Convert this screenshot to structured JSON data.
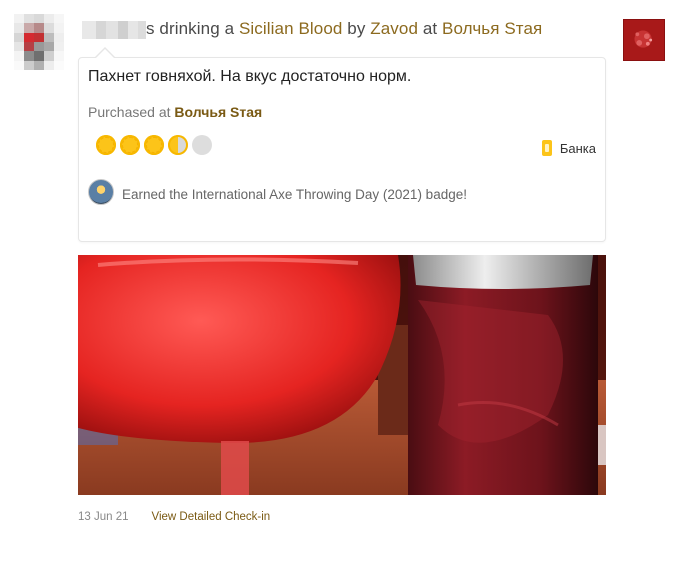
{
  "checkin": {
    "user_name_redacted": "",
    "action_text": "s drinking a",
    "beer_name": "Sicilian Blood",
    "by_text": "by",
    "brewery_name": "Zavod",
    "at_text": "at",
    "venue_name": "Волчья Sтая"
  },
  "comment": {
    "text": "Пахнет говняхой. На вкус достаточно норм."
  },
  "purchase": {
    "label": "Purchased at",
    "venue": "Волчья Sтая"
  },
  "rating": {
    "value": 3.5,
    "max": 5,
    "caps": [
      "full",
      "full",
      "full",
      "half",
      "empty"
    ]
  },
  "serving": {
    "icon": "can-icon",
    "label": "Банка"
  },
  "badge": {
    "icon": "badge-icon",
    "text": "Earned the International Axe Throwing Day (2021) badge!"
  },
  "footer": {
    "date": "13 Jun 21",
    "detail_link": "View Detailed Check-in"
  },
  "colors": {
    "link": "#8c6a1f",
    "cap_full": "#fcc419",
    "cap_empty": "#dddddd",
    "venue_thumb": "#a91818"
  }
}
